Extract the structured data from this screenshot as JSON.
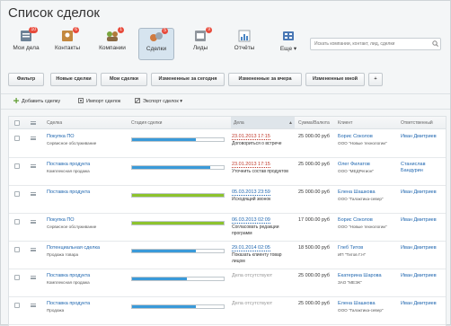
{
  "title": "Список сделок",
  "nav": [
    {
      "label": "Мои дела",
      "badge": "10",
      "color": "#5b6f83"
    },
    {
      "label": "Контакты",
      "badge": "6",
      "color": "#b07a3a"
    },
    {
      "label": "Компании",
      "badge": "1",
      "color": "#6f9a3a"
    },
    {
      "label": "Сделки",
      "badge": "5",
      "color": "#c06a3b"
    },
    {
      "label": "Лиды",
      "badge": "9",
      "color": "#8a8f97"
    },
    {
      "label": "Отчёты",
      "badge": "",
      "color": "#4a86c5"
    },
    {
      "label": "Еще ▾",
      "badge": "",
      "color": "#4a78b5"
    }
  ],
  "search": {
    "placeholder": "Искать компании, контакт, лид, сделки"
  },
  "filters": [
    "Фильтр",
    "Новые сделки",
    "Мои сделки",
    "Измененные за сегодня",
    "Измененные за вчера",
    "Измененные мной",
    "+"
  ],
  "toolbar": {
    "add": "Добавить сделку",
    "import": "Импорт сделок",
    "export": "Экспорт сделок ▾"
  },
  "columns": [
    "Сделка",
    "Стадия сделки",
    "Дела",
    "Сумма/Валюта",
    "Клиент",
    "Ответственный"
  ],
  "colors": {
    "blue_stage": "#3a9ad9",
    "green_stage": "#8dc32d",
    "red_date": "#c0392b",
    "blue_date": "#2067b0",
    "gray_date": "#999999"
  },
  "deals": [
    {
      "name": "Покупка ПО",
      "type": "Сервисное обслуживание",
      "progress": 0.7,
      "stage_color": "#3a9ad9",
      "date": "23.01.2013 17:15",
      "date_color": "#c0392b",
      "activity": "Договориться о встрече",
      "amount": "25 000.00 руб",
      "client": "Борис Соколов",
      "company": "ООО \"Новые технологии\"",
      "responsible": "Иван Дмитриев"
    },
    {
      "name": "Поставка продукта",
      "type": "Комплексная продажа",
      "progress": 0.85,
      "stage_color": "#3a9ad9",
      "date": "23.01.2013 17:15",
      "date_color": "#c0392b",
      "activity": "Уточнить состав продуктов",
      "amount": "25 000.00 руб",
      "client": "Олег Филатов",
      "company": "ООО \"МЕДРегион\"",
      "responsible": "Станислав Бандурин"
    },
    {
      "name": "Поставка продукта",
      "type": "",
      "progress": 1.0,
      "stage_color": "#8dc32d",
      "date": "05.03.2013 23:59",
      "date_color": "#2067b0",
      "activity": "Исходящий звонок",
      "amount": "25 000.00 руб",
      "client": "Елена Шашкова",
      "company": "ООО \"Галактика-север\"",
      "responsible": "Иван Дмитриев"
    },
    {
      "name": "Покупка ПО",
      "type": "Сервисное обслуживание",
      "progress": 1.0,
      "stage_color": "#8dc32d",
      "date": "06.03.2013 02:09",
      "date_color": "#2067b0",
      "activity": "Согласовать редакции программ",
      "amount": "17 000.00 руб",
      "client": "Борис Соколов",
      "company": "ООО \"Новые технологии\"",
      "responsible": "Иван Дмитриев"
    },
    {
      "name": "Потенциальная сделка",
      "type": "Продажа товара",
      "progress": 0.7,
      "stage_color": "#3a9ad9",
      "date": "29.01.2014 02:05",
      "date_color": "#2067b0",
      "activity": "Показать клиенту товар лицом",
      "amount": "18 500.00 руб",
      "client": "Глеб Титов",
      "company": "ИП \"Титов Г.Н\"",
      "responsible": "Иван Дмитриев"
    },
    {
      "name": "Поставка продукта",
      "type": "Комплексная продажа",
      "progress": 0.6,
      "stage_color": "#3a9ad9",
      "date": "Дела отсутствуют",
      "date_color": "#999999",
      "activity": "",
      "amount": "25 000.00 руб",
      "client": "Екатерина Шарова",
      "company": "ЗАО \"МЕЭК\"",
      "responsible": "Иван Дмитриев"
    },
    {
      "name": "Поставка продукта",
      "type": "Продажа",
      "progress": 0.7,
      "stage_color": "#3a9ad9",
      "date": "Дела отсутствуют",
      "date_color": "#999999",
      "activity": "",
      "amount": "25 000.00 руб",
      "client": "Елена Шашкова",
      "company": "ООО \"Галактика-север\"",
      "responsible": "Иван Дмитриев"
    }
  ]
}
